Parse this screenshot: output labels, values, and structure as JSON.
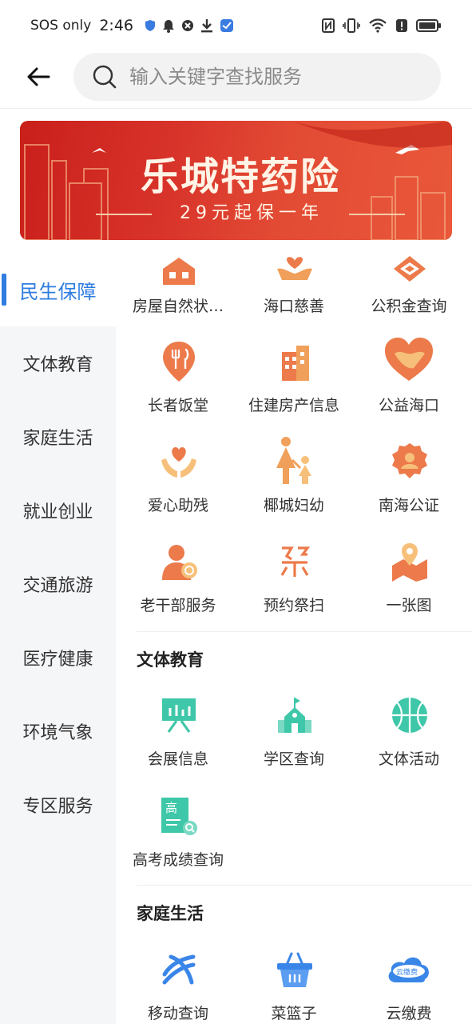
{
  "status_bar": {
    "carrier": "SOS only",
    "time": "2:46"
  },
  "search": {
    "placeholder": "输入关键字查找服务"
  },
  "banner": {
    "title": "乐城特药险",
    "subtitle": "29元起保一年"
  },
  "sidebar": {
    "items": [
      {
        "label": "民生保障"
      },
      {
        "label": "文体教育"
      },
      {
        "label": "家庭生活"
      },
      {
        "label": "就业创业"
      },
      {
        "label": "交通旅游"
      },
      {
        "label": "医疗健康"
      },
      {
        "label": "环境气象"
      },
      {
        "label": "专区服务"
      }
    ]
  },
  "sections": {
    "minsheng": {
      "items": [
        {
          "label": "房屋自然状…",
          "icon": "house-icon"
        },
        {
          "label": "海口慈善",
          "icon": "charity-hand-icon"
        },
        {
          "label": "公积金查询",
          "icon": "fund-icon"
        },
        {
          "label": "长者饭堂",
          "icon": "dining-icon"
        },
        {
          "label": "住建房产信息",
          "icon": "building-icon"
        },
        {
          "label": "公益海口",
          "icon": "heart-hand-icon"
        },
        {
          "label": "爱心助残",
          "icon": "love-hands-icon"
        },
        {
          "label": "椰城妇幼",
          "icon": "mother-child-icon"
        },
        {
          "label": "南海公证",
          "icon": "notary-icon"
        },
        {
          "label": "老干部服务",
          "icon": "elder-service-icon"
        },
        {
          "label": "预约祭扫",
          "icon": "memorial-icon"
        },
        {
          "label": "一张图",
          "icon": "map-pin-icon"
        }
      ]
    },
    "wenti": {
      "title": "文体教育",
      "items": [
        {
          "label": "会展信息",
          "icon": "exhibition-icon"
        },
        {
          "label": "学区查询",
          "icon": "school-icon"
        },
        {
          "label": "文体活动",
          "icon": "basketball-icon"
        },
        {
          "label": "高考成绩查询",
          "icon": "exam-score-icon",
          "glyph": "高"
        }
      ]
    },
    "jiating": {
      "title": "家庭生活",
      "items": [
        {
          "label": "移动查询",
          "icon": "mobile-logo-icon"
        },
        {
          "label": "菜篮子",
          "icon": "basket-icon"
        },
        {
          "label": "云缴费",
          "icon": "cloud-pay-icon",
          "glyph": "云缴费"
        }
      ]
    }
  },
  "colors": {
    "accent": "#2f7de0",
    "orange": "#ec7a4a",
    "teal": "#3ec7a8",
    "blue": "#3a86e8",
    "banner_red": "#d8332a"
  }
}
